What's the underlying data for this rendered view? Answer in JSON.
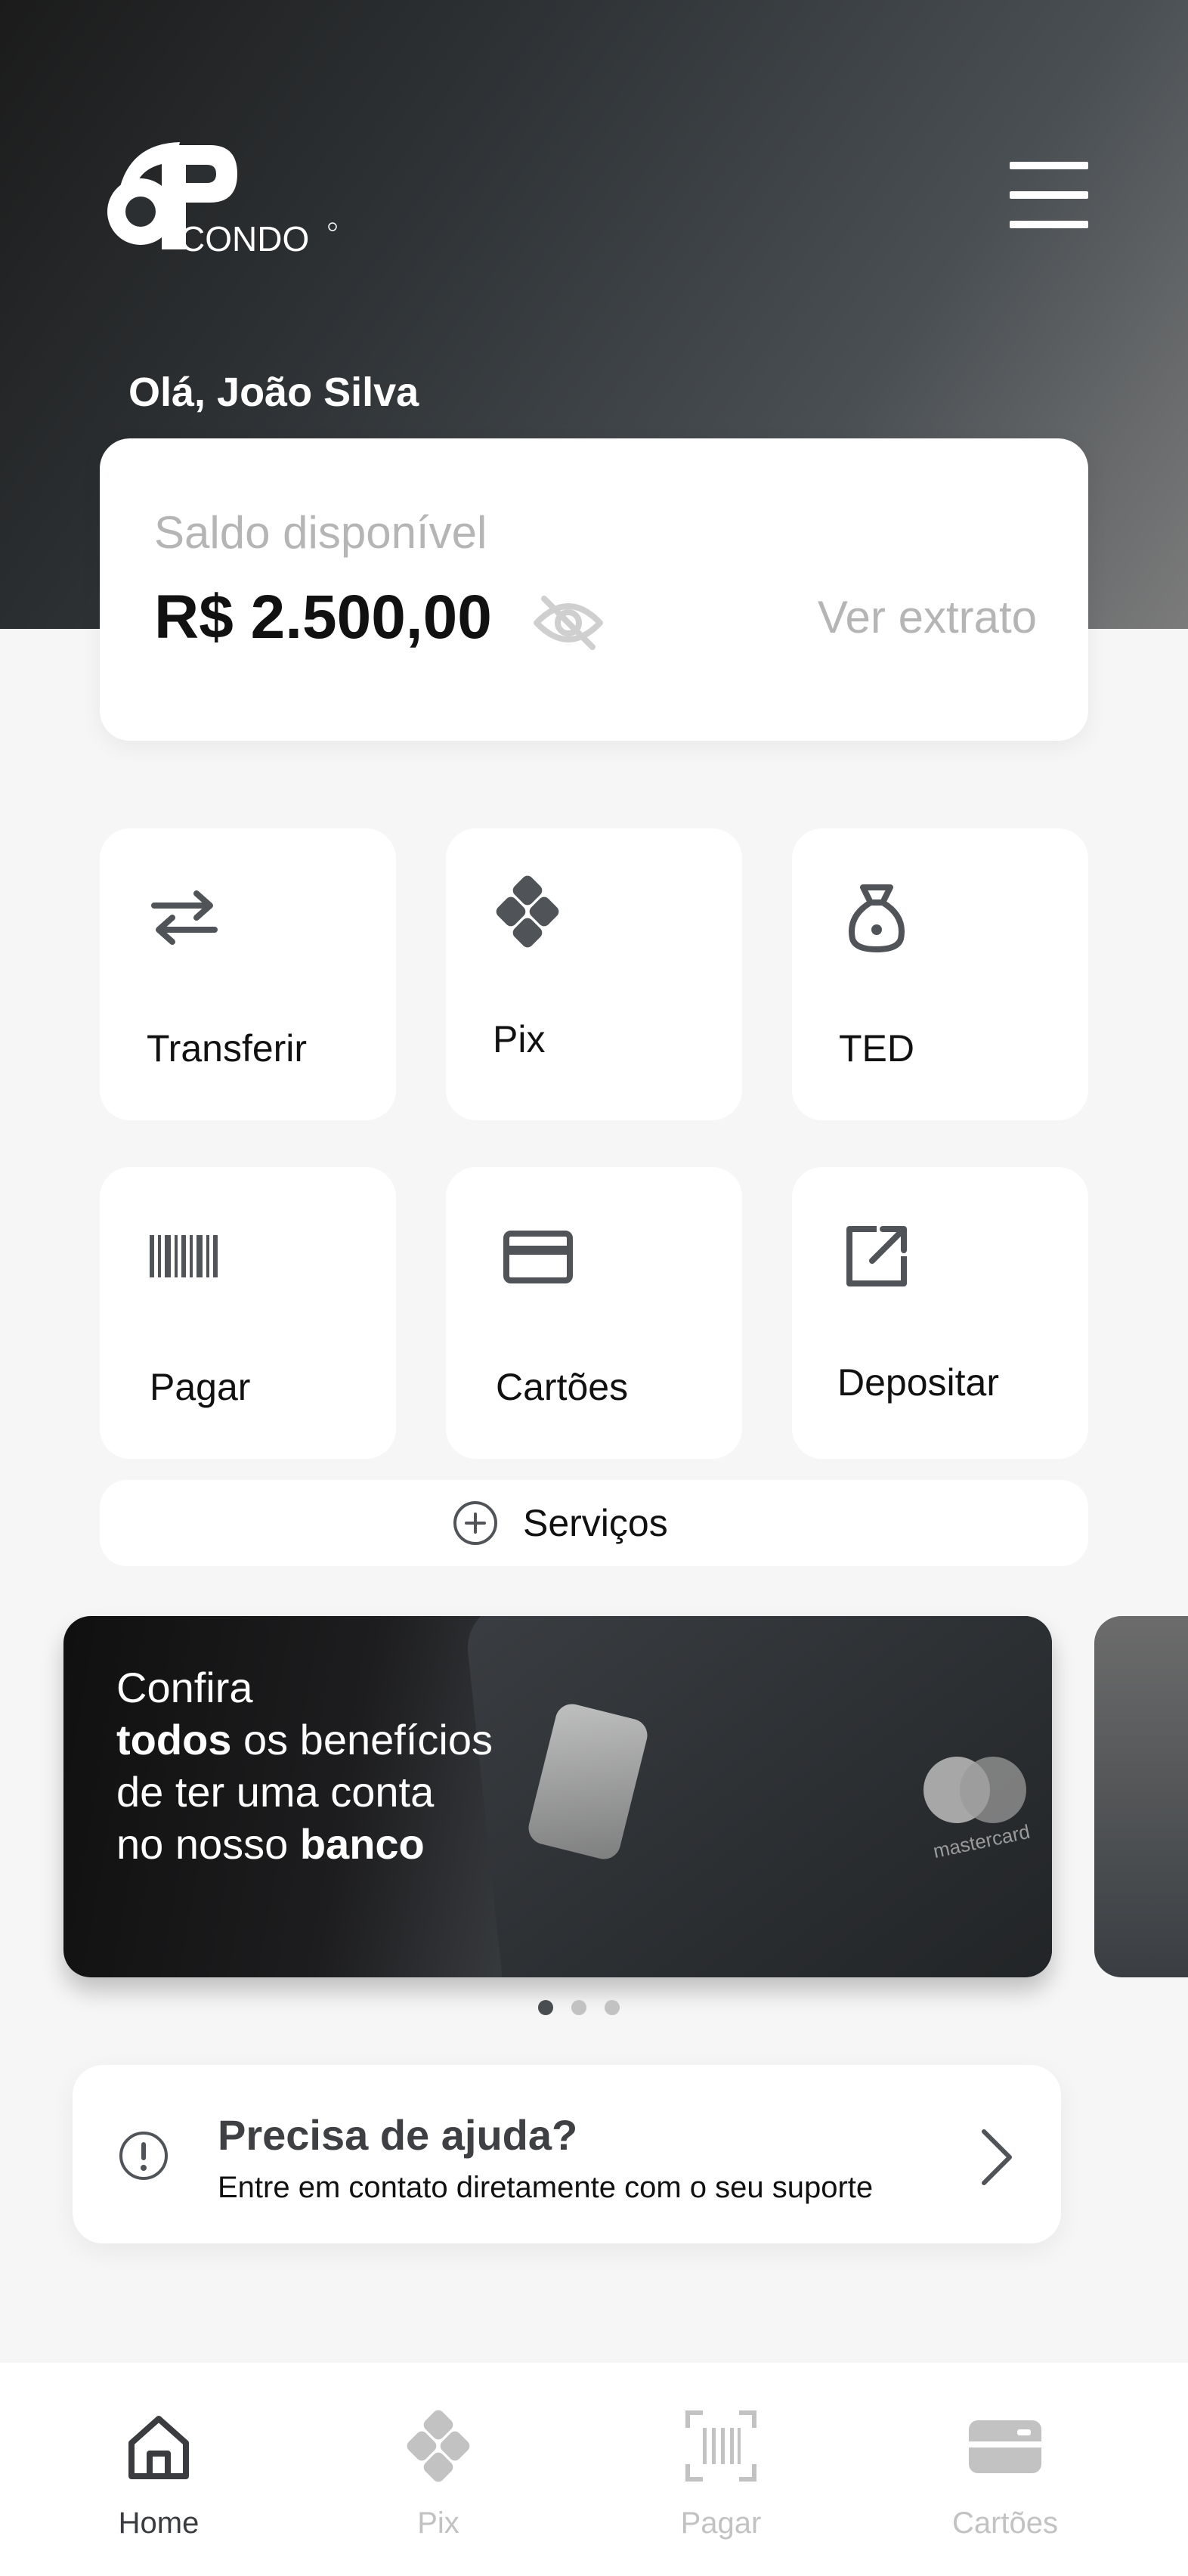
{
  "header": {
    "logo_mark": "6P",
    "logo_text": "CONDO",
    "greeting": "Olá, João Silva"
  },
  "balance": {
    "label": "Saldo disponível",
    "value": "R$ 2.500,00",
    "statement_link": "Ver extrato",
    "visibility_icon": "eye-off-icon"
  },
  "actions": [
    {
      "label": "Transferir",
      "icon": "transfer-icon"
    },
    {
      "label": "Pix",
      "icon": "pix-icon"
    },
    {
      "label": "TED",
      "icon": "money-bag-icon"
    },
    {
      "label": "Pagar",
      "icon": "barcode-icon"
    },
    {
      "label": "Cartões",
      "icon": "card-icon"
    },
    {
      "label": "Depositar",
      "icon": "external-link-icon"
    }
  ],
  "services": {
    "label": "Serviços",
    "icon": "plus-circle-icon"
  },
  "banner": {
    "line1": "Confira",
    "line2_bold": "todos",
    "line2_rest": " os benefícios",
    "line3": "de ter uma conta",
    "line4_start": "no nosso ",
    "line4_bold": "banco",
    "card_brand": "mastercard"
  },
  "carousel": {
    "pages": 3,
    "active_index": 0
  },
  "help": {
    "title": "Precisa de ajuda?",
    "subtitle": "Entre em contato diretamente com o seu suporte"
  },
  "bottom_nav": [
    {
      "label": "Home",
      "icon": "home-icon",
      "active": true
    },
    {
      "label": "Pix",
      "icon": "pix-icon",
      "active": false
    },
    {
      "label": "Pagar",
      "icon": "barcode-scan-icon",
      "active": false
    },
    {
      "label": "Cartões",
      "icon": "card-icon",
      "active": false
    }
  ],
  "colors": {
    "primary_dark": "#3a3c40",
    "inactive": "#c2c2c2",
    "background": "#f6f6f6",
    "muted_text": "#b5b5b5"
  }
}
